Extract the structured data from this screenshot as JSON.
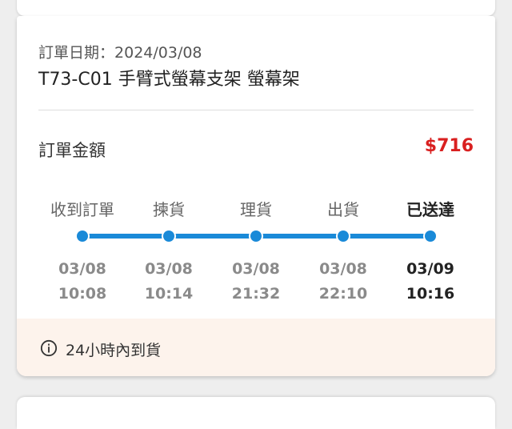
{
  "order": {
    "date_label": "訂單日期：",
    "date_value": "2024/03/08",
    "product": "T73-C01 手臂式螢幕支架 螢幕架",
    "amount_label": "訂單金額",
    "amount": "$716"
  },
  "progress": {
    "steps": [
      {
        "label": "收到訂單",
        "date": "03/08",
        "time": "10:08"
      },
      {
        "label": "揀貨",
        "date": "03/08",
        "time": "10:14"
      },
      {
        "label": "理貨",
        "date": "03/08",
        "time": "21:32"
      },
      {
        "label": "出貨",
        "date": "03/08",
        "time": "22:10"
      },
      {
        "label": "已送達",
        "date": "03/09",
        "time": "10:16"
      }
    ],
    "current_step": 5
  },
  "notice": {
    "icon": "info-icon",
    "text": "24小時內到貨"
  },
  "colors": {
    "accent": "#1a8ad8",
    "price": "#d92020",
    "notice_bg": "#fdf3ec"
  }
}
